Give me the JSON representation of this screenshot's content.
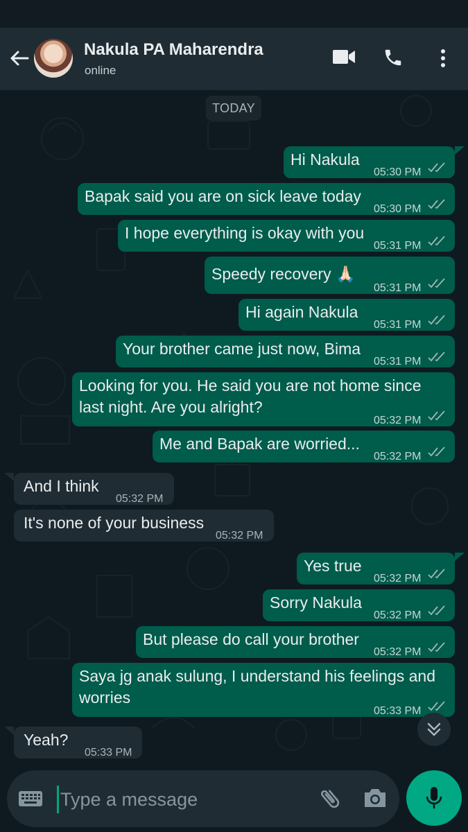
{
  "header": {
    "contact_name": "Nakula PA Maharendra",
    "contact_status": "online"
  },
  "chat": {
    "date_label": "TODAY",
    "messages": [
      {
        "dir": "out",
        "text": "Hi Nakula",
        "time": "05:30 PM"
      },
      {
        "dir": "out",
        "text": "Bapak said you are on sick leave today",
        "time": "05:30 PM"
      },
      {
        "dir": "out",
        "text": "I hope everything is okay with you",
        "time": "05:31 PM"
      },
      {
        "dir": "out",
        "text": "Speedy recovery 🙏🏻",
        "time": "05:31 PM"
      },
      {
        "dir": "out",
        "text": "Hi again Nakula",
        "time": "05:31 PM"
      },
      {
        "dir": "out",
        "text": "Your brother came just now, Bima",
        "time": "05:31 PM"
      },
      {
        "dir": "out",
        "text_line1": "Looking for you. He said you are not home since",
        "text_line2": "last night. Are you alright?",
        "time": "05:32 PM"
      },
      {
        "dir": "out",
        "text": "Me and Bapak are worried...",
        "time": "05:32 PM"
      },
      {
        "dir": "in",
        "text": "And I think",
        "time": "05:32 PM"
      },
      {
        "dir": "in",
        "text": "It's none of your business",
        "time": "05:32 PM"
      },
      {
        "dir": "out",
        "text": "Yes true",
        "time": "05:32 PM"
      },
      {
        "dir": "out",
        "text": "Sorry Nakula",
        "time": "05:32 PM"
      },
      {
        "dir": "out",
        "text": "But please do call your brother",
        "time": "05:32 PM"
      },
      {
        "dir": "out",
        "text_line1": "Saya jg anak sulung, I understand his feelings and",
        "text_line2": "worries",
        "time": "05:33 PM"
      },
      {
        "dir": "in",
        "text": "Yeah?",
        "time": "05:33 PM"
      }
    ]
  },
  "composer": {
    "placeholder": "Type a message"
  },
  "colors": {
    "outgoing_bubble": "#005c4b",
    "incoming_bubble": "#1f2c33",
    "accent": "#00a884",
    "read_ticks": "#9fb8b2"
  },
  "icons": [
    "back-arrow-icon",
    "video-call-icon",
    "phone-icon",
    "more-vert-icon",
    "double-check-icon",
    "chevron-double-down-icon",
    "keyboard-icon",
    "attach-icon",
    "camera-icon",
    "mic-icon"
  ]
}
